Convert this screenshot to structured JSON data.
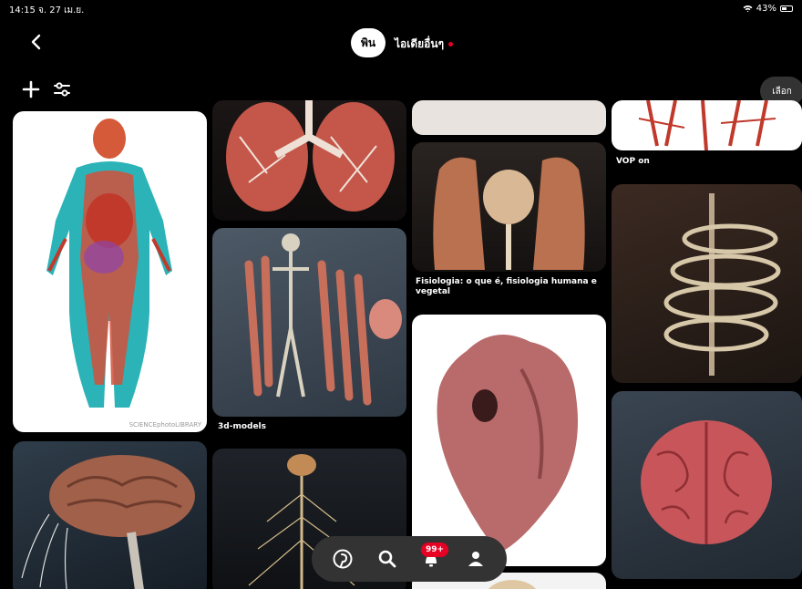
{
  "status_bar": {
    "time": "14:15  จ. 27 เม.ย.",
    "battery": "43%"
  },
  "header": {
    "board_pill": "พิน",
    "board_title": "ไอเดียอื่นๆ"
  },
  "toolbar": {
    "select_label": "เลือก"
  },
  "pins": [
    {
      "caption": ""
    },
    {
      "caption": ""
    },
    {
      "caption": "3d-models"
    },
    {
      "caption": ""
    },
    {
      "caption": ""
    },
    {
      "caption": "Fisiologia: o que é, fisiologia humana e vegetal"
    },
    {
      "caption": ""
    },
    {
      "caption": ""
    },
    {
      "caption": "VOP on"
    },
    {
      "caption": ""
    },
    {
      "caption": ""
    }
  ],
  "watermark": "SCIENCEphotoLIBRARY",
  "bottom_nav": {
    "notification_badge": "99+"
  },
  "icons": [
    "back-icon",
    "plus-icon",
    "filter-icon",
    "pinterest-icon",
    "search-icon",
    "bell-icon",
    "profile-icon"
  ]
}
